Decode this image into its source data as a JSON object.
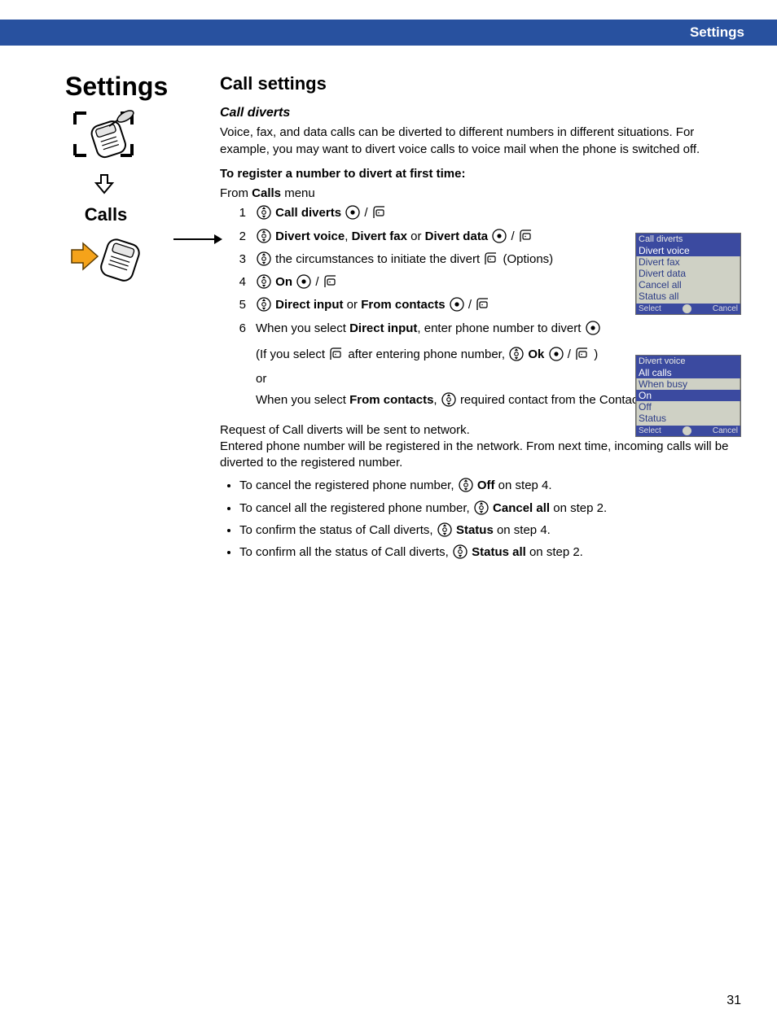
{
  "header": {
    "title": "Settings"
  },
  "side": {
    "title": "Settings",
    "subtitle": "Calls"
  },
  "main": {
    "section_title": "Call settings",
    "subsection_title": "Call diverts",
    "lead": "Voice, fax, and data calls can be diverted to different numbers in different situations. For example, you may want to divert voice calls to voice mail when the phone is switched off.",
    "instr_heading": "To register a number to divert at first time:",
    "from_prefix": "From ",
    "from_bold": "Calls",
    "from_suffix": " menu",
    "steps": {
      "s1_bold": "Call diverts",
      "s2_b1": "Divert voice",
      "s2_mid1": ", ",
      "s2_b2": "Divert fax",
      "s2_mid2": " or ",
      "s2_b3": "Divert data",
      "s3_text": "the circumstances to initiate the divert ",
      "s3_options": " (Options)",
      "s4_bold": "On",
      "s5_b1": "Direct input",
      "s5_mid": " or ",
      "s5_b2": "From contacts",
      "s6_pre": "When you select ",
      "s6_bold": "Direct input",
      "s6_post": ", enter phone number to divert "
    },
    "if_line_pre": "(If you select ",
    "if_line_mid": " after entering phone number, ",
    "if_line_bold": "Ok",
    "if_line_close": " )",
    "or": "or",
    "from_contacts_pre": "When you select ",
    "from_contacts_bold": "From contacts",
    "from_contacts_mid": ", ",
    "from_contacts_post": " required contact from the Contacts list ",
    "request_line": "Request of Call diverts will be sent to network.",
    "registered_line": "Entered phone number will be registered in the network. From next time, incoming calls will be diverted to the registered number.",
    "bullets": {
      "b1_pre": "To cancel the registered phone number, ",
      "b1_bold": "Off",
      "b1_post": " on step 4.",
      "b2_pre": "To cancel all the registered phone number, ",
      "b2_bold": "Cancel all",
      "b2_post": " on step 2.",
      "b3_pre": "To confirm the status of Call diverts, ",
      "b3_bold": "Status",
      "b3_post": " on step 4.",
      "b4_pre": "To confirm all the status of Call diverts, ",
      "b4_bold": "Status all",
      "b4_post": " on step 2."
    }
  },
  "screen1": {
    "title": "Call diverts",
    "highlight": "Divert voice",
    "rows": [
      "Divert fax",
      "Divert data",
      "Cancel all",
      "Status all"
    ],
    "soft_left": "Select",
    "soft_right": "Cancel"
  },
  "screen2": {
    "title": "Divert voice",
    "row_hl1": "All calls",
    "row_plain": "When busy",
    "row_hl2": "On",
    "rows_after": [
      "Off",
      "Status"
    ],
    "soft_left": "Select",
    "soft_right": "Cancel"
  },
  "page_number": "31"
}
